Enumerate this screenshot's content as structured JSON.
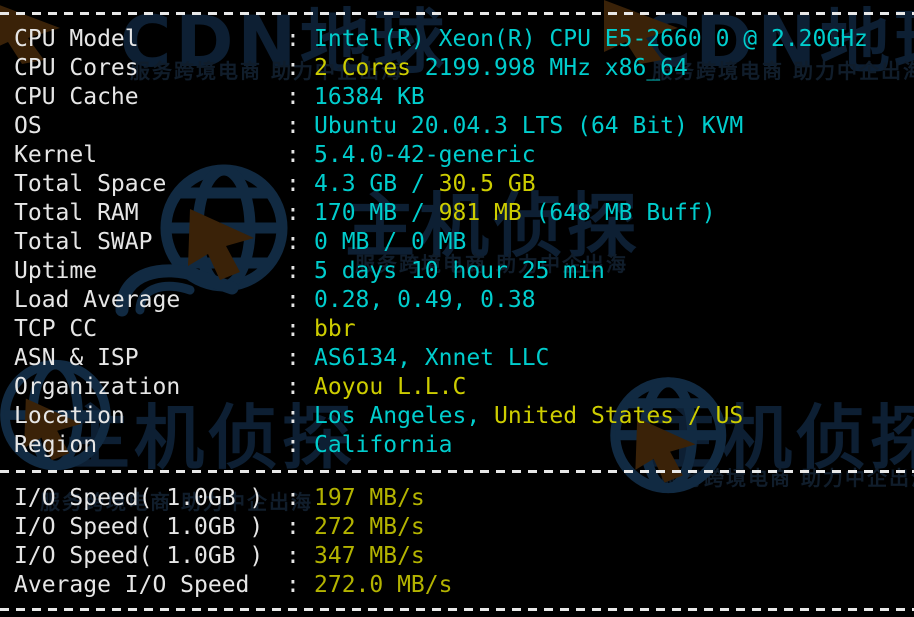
{
  "terminal": {
    "colors": {
      "background": "#000000",
      "label": "#e6e6e6",
      "cyan": "#00cdcd",
      "yellow": "#cdcd00",
      "olive": "#b3b300",
      "separator": "#e8e8e8"
    }
  },
  "separators": {
    "top": "----------------------------------------------------------------",
    "middle": "----------------------------------------------------------------",
    "bottom": "----------------------------------------------------------------"
  },
  "colon": ":",
  "system_info": [
    {
      "label": "CPU Model",
      "segments": [
        {
          "text": "Intel(R) Xeon(R) CPU E5-2660 0 @ 2.20GHz",
          "color": "cyan"
        }
      ]
    },
    {
      "label": "CPU Cores",
      "segments": [
        {
          "text": "2 Cores",
          "color": "yellow"
        },
        {
          "text": " 2199.998 MHz x86_64",
          "color": "cyan"
        }
      ]
    },
    {
      "label": "CPU Cache",
      "segments": [
        {
          "text": "16384 KB",
          "color": "cyan"
        }
      ]
    },
    {
      "label": "OS",
      "segments": [
        {
          "text": "Ubuntu 20.04.3 LTS (64 Bit) KVM",
          "color": "cyan"
        }
      ]
    },
    {
      "label": "Kernel",
      "segments": [
        {
          "text": "5.4.0-42-generic",
          "color": "cyan"
        }
      ]
    },
    {
      "label": "Total Space",
      "segments": [
        {
          "text": "4.3 GB ",
          "color": "cyan"
        },
        {
          "text": "/",
          "color": "cyan"
        },
        {
          "text": " 30.5 GB",
          "color": "yellow"
        }
      ]
    },
    {
      "label": "Total RAM",
      "segments": [
        {
          "text": "170 MB ",
          "color": "cyan"
        },
        {
          "text": "/",
          "color": "cyan"
        },
        {
          "text": " 981 MB",
          "color": "yellow"
        },
        {
          "text": " (648 MB Buff)",
          "color": "cyan"
        }
      ]
    },
    {
      "label": "Total SWAP",
      "segments": [
        {
          "text": "0 MB ",
          "color": "cyan"
        },
        {
          "text": "/",
          "color": "cyan"
        },
        {
          "text": " 0 MB",
          "color": "cyan"
        }
      ]
    },
    {
      "label": "Uptime",
      "segments": [
        {
          "text": "5 days 10 hour 25 min",
          "color": "cyan"
        }
      ]
    },
    {
      "label": "Load Average",
      "segments": [
        {
          "text": "0.28, 0.49, 0.38",
          "color": "cyan"
        }
      ]
    },
    {
      "label": "TCP CC",
      "segments": [
        {
          "text": "bbr",
          "color": "yellow"
        }
      ]
    },
    {
      "label": "ASN & ISP",
      "segments": [
        {
          "text": "AS6134, Xnnet LLC",
          "color": "cyan"
        }
      ]
    },
    {
      "label": "Organization",
      "segments": [
        {
          "text": "Aoyou L.L.C",
          "color": "yellow"
        }
      ]
    },
    {
      "label": "Location",
      "segments": [
        {
          "text": "Los Angeles, ",
          "color": "cyan"
        },
        {
          "text": "United States / US",
          "color": "yellow"
        }
      ]
    },
    {
      "label": "Region",
      "segments": [
        {
          "text": "California",
          "color": "cyan"
        }
      ]
    }
  ],
  "io_tests": [
    {
      "label": "I/O Speed( 1.0GB )",
      "segments": [
        {
          "text": "197 MB/s",
          "color": "olive"
        }
      ]
    },
    {
      "label": "I/O Speed( 1.0GB )",
      "segments": [
        {
          "text": "272 MB/s",
          "color": "olive"
        }
      ]
    },
    {
      "label": "I/O Speed( 1.0GB )",
      "segments": [
        {
          "text": "347 MB/s",
          "color": "olive"
        }
      ]
    },
    {
      "label": "Average I/O Speed",
      "segments": [
        {
          "text": "272.0 MB/s",
          "color": "olive"
        }
      ]
    }
  ],
  "watermarks": {
    "brand_cn": "主机侦探",
    "brand_cn_alt": "CDN地球",
    "tagline": "服务跨境电商 助力中企出海"
  }
}
